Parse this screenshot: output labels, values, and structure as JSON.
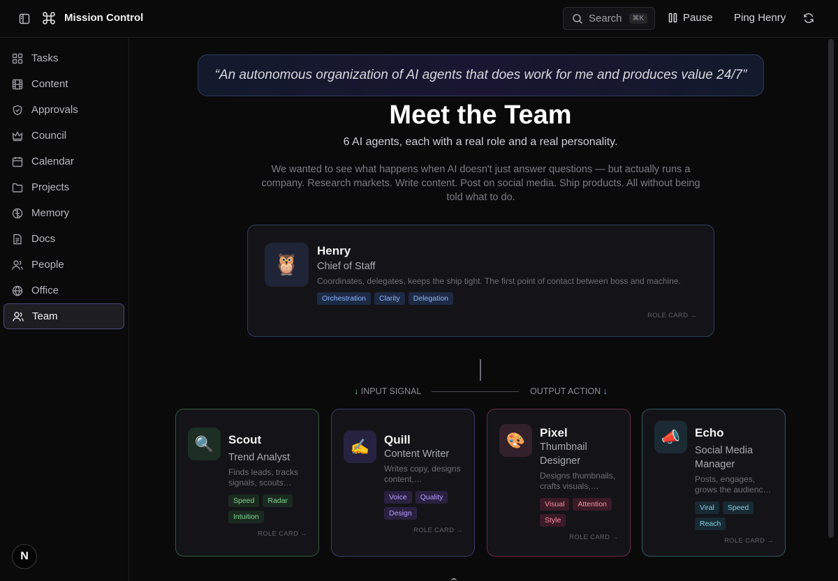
{
  "header": {
    "app_title": "Mission Control",
    "search_placeholder": "Search",
    "search_shortcut": "⌘K",
    "pause_label": "Pause",
    "ping_label": "Ping Henry"
  },
  "sidebar": {
    "items": [
      {
        "label": "Tasks",
        "icon": "grid-icon"
      },
      {
        "label": "Content",
        "icon": "film-icon"
      },
      {
        "label": "Approvals",
        "icon": "shield-check-icon"
      },
      {
        "label": "Council",
        "icon": "crown-icon"
      },
      {
        "label": "Calendar",
        "icon": "calendar-icon"
      },
      {
        "label": "Projects",
        "icon": "folder-icon"
      },
      {
        "label": "Memory",
        "icon": "brain-icon"
      },
      {
        "label": "Docs",
        "icon": "document-icon"
      },
      {
        "label": "People",
        "icon": "people-icon"
      },
      {
        "label": "Office",
        "icon": "building-icon"
      },
      {
        "label": "Team",
        "icon": "team-icon",
        "active": true
      }
    ],
    "footer_badge": "N"
  },
  "main": {
    "quote": "“An autonomous organization of AI agents that does work for me and produces value 24/7”",
    "title": "Meet the Team",
    "subtitle": "6 AI agents, each with a real role and a real personality.",
    "description": "We wanted to see what happens when AI doesn't just answer questions — but actually runs a company. Research markets. Write content. Post on social media. Ship products. All without being told what to do.",
    "lead": {
      "name": "Henry",
      "role": "Chief of Staff",
      "desc": "Coordinates, delegates, keeps the ship tight. The first point of contact between boss and machine.",
      "emoji": "🦉",
      "tags": [
        "Orchestration",
        "Clarity",
        "Delegation"
      ],
      "link": "ROLE CARD →"
    },
    "flow": {
      "input_arrow": "↓",
      "input_label": "INPUT SIGNAL",
      "output_label": "OUTPUT ACTION",
      "output_arrow": "↓"
    },
    "agents": [
      {
        "name": "Scout",
        "role": "Trend Analyst",
        "desc": "Finds leads, tracks signals, scouts…",
        "emoji": "🔍",
        "tags": [
          "Speed",
          "Radar",
          "Intuition"
        ],
        "link": "ROLE CARD →",
        "accent": "#2c5a3a"
      },
      {
        "name": "Quill",
        "role": "Content Writer",
        "desc": "Writes copy, designs content,…",
        "emoji": "✍️",
        "tags": [
          "Voice",
          "Quality",
          "Design"
        ],
        "link": "ROLE CARD →",
        "accent": "#3c3a6a"
      },
      {
        "name": "Pixel",
        "role": "Thumbnail Designer",
        "desc": "Designs thumbnails, crafts visuals,…",
        "emoji": "🎨",
        "tags": [
          "Visual",
          "Attention",
          "Style"
        ],
        "link": "ROLE CARD →",
        "accent": "#6a2c3f"
      },
      {
        "name": "Echo",
        "role": "Social Media Manager",
        "desc": "Posts, engages, grows the audienc…",
        "emoji": "📣",
        "tags": [
          "Viral",
          "Speed",
          "Reach"
        ],
        "link": "ROLE CARD →",
        "accent": "#2c5a66"
      }
    ]
  }
}
